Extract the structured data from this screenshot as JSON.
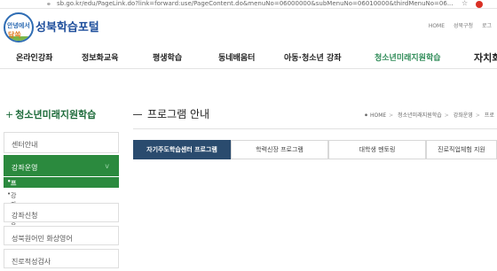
{
  "browser": {
    "url": "sb.go.kr/edu/PageLink.do?link=forward:use/PageContent.do&menuNo=06000000&subMenuNo=06010000&thirdMenuNo=06...",
    "icons": [
      "lock-icon",
      "star-icon",
      "extension-icon"
    ]
  },
  "header": {
    "logo_line1": "안녕에서",
    "logo_line2": "담쏙",
    "site_name": "성북학습포털",
    "utils": [
      "HOME",
      "성북구청",
      "로그"
    ]
  },
  "gnb": {
    "items": [
      "온라인강좌",
      "정보화교육",
      "평생학습",
      "동네배움터",
      "아동·청소년 강좌",
      "청소년미래지원학습",
      "자치회"
    ]
  },
  "sidebar": {
    "title": "청소년미래지원학습",
    "menu": [
      {
        "label": "센터안내"
      },
      {
        "label": "강좌운영",
        "chevron": "v"
      },
      {
        "label": "강좌신청"
      },
      {
        "label": "성북원어민 화상영어"
      },
      {
        "label": "진로적성검사"
      }
    ],
    "sub": [
      {
        "label": "프로그램 안내"
      },
      {
        "label": "강좌 이용방법"
      }
    ]
  },
  "content": {
    "title": "프로그램 안내",
    "breadcrumb": [
      "HOME",
      "청소년미래지원학습",
      "강좌운영",
      "프로"
    ],
    "tabs": [
      "자기주도학습센터 프로그램",
      "학력신장 프로그램",
      "대학생 멘토링",
      "진로직업체험 지원"
    ]
  },
  "colors": {
    "brand_blue": "#1f4f9c",
    "green": "#2b8a3e",
    "tab_active": "#2a4b6e"
  }
}
